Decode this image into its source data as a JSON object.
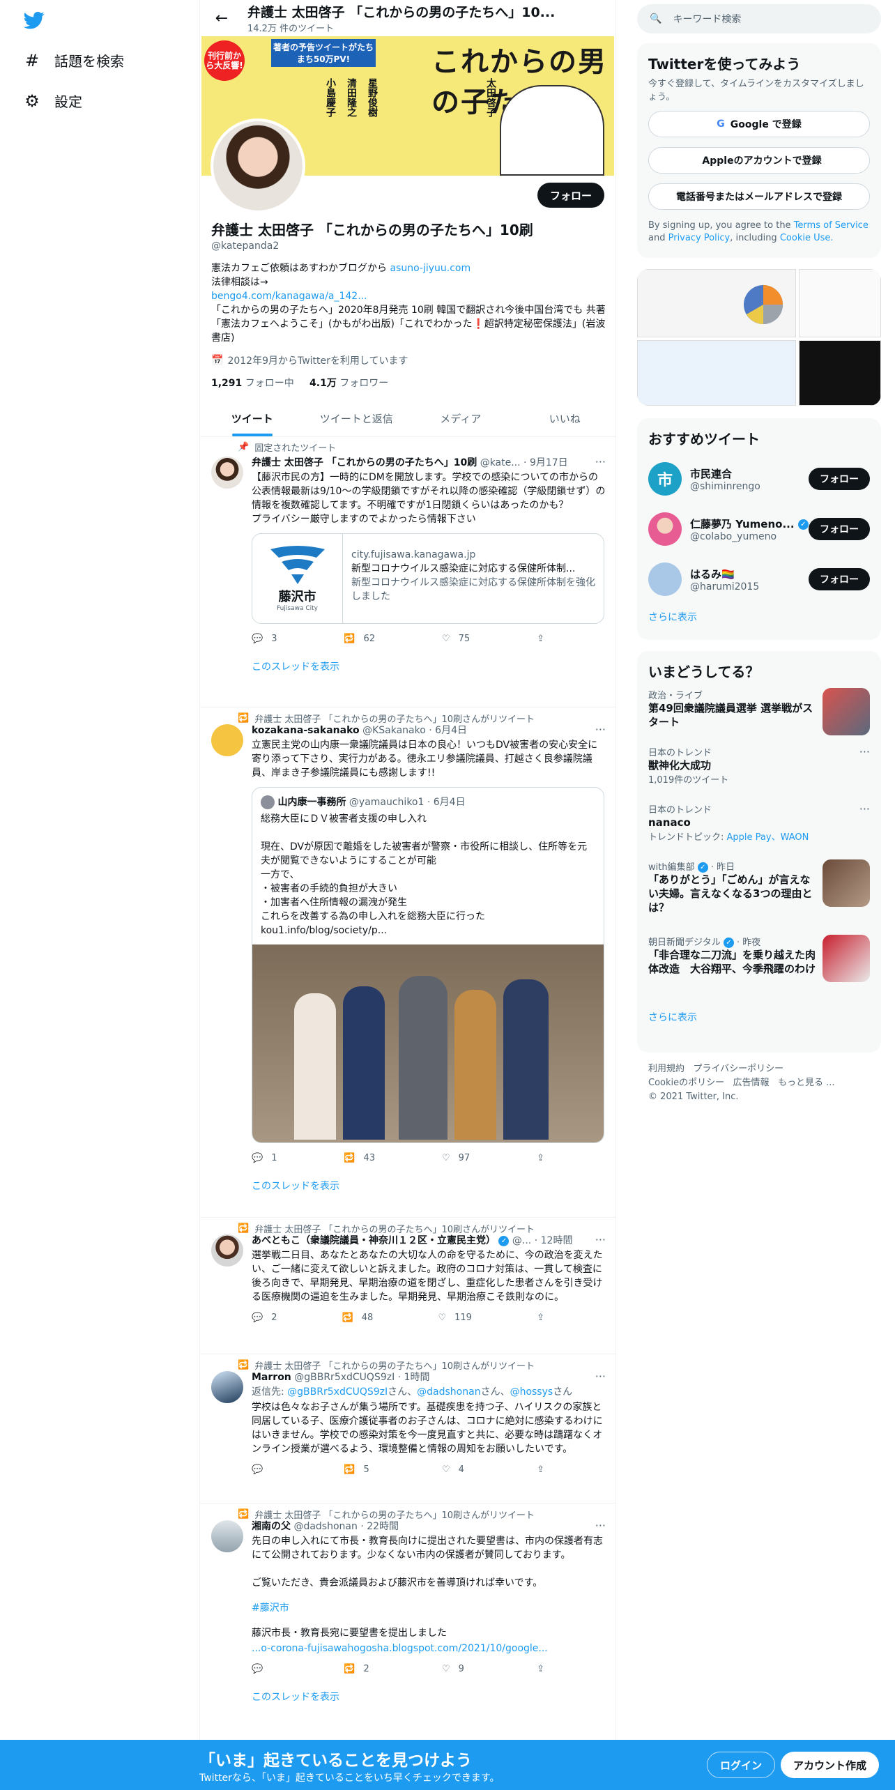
{
  "nav": {
    "explore_label": "話題を検索",
    "settings_label": "設定"
  },
  "header": {
    "title": "弁護士 太田啓子 「これからの男の子たちへ」10...",
    "tweet_count": "14.2万 件のツイート"
  },
  "banner": {
    "badge": "刊行前から大反響!",
    "promo": "著者の予告ツイートがたちまち50万PV!",
    "book_title": "これからの男の子たちへ",
    "authors": [
      "小島慶子",
      "清田隆之",
      "星野俊樹",
      "太田啓子"
    ]
  },
  "profile": {
    "name": "弁護士 太田啓子 「これからの男の子たちへ」10刷",
    "handle": "@katepanda2",
    "follow_label": "フォロー",
    "bio_line1": "憲法カフェご依頼はあすわかブログから",
    "bio_link1": "asuno-jiyuu.com",
    "bio_line2": "法律相談は→",
    "bio_link2": "bengo4.com/kanagawa/a_142...",
    "bio_line3": "「これからの男の子たちへ」2020年8月発売 10刷 韓国で翻訳され今後中国台湾でも 共著「憲法カフェへようこそ」(かもがわ出版)「これでわかった❗超訳特定秘密保護法」(岩波書店)",
    "joined": "2012年9月からTwitterを利用しています",
    "following_count": "1,291",
    "following_label": "フォロー中",
    "followers_count": "4.1万",
    "followers_label": "フォロワー"
  },
  "tabs": [
    "ツイート",
    "ツイートと返信",
    "メディア",
    "いいね"
  ],
  "tweets": [
    {
      "context": "固定されたツイート",
      "name": "弁護士 太田啓子 「これからの男の子たちへ」10刷",
      "handle": "@kate...",
      "time": "9月17日",
      "text": "【藤沢市民の方】一時的にDMを開放します。学校での感染についての市からの公表情報最新は9/10～の学級閉鎖ですがそれ以降の感染確認（学級閉鎖せず）の情報を複数確認してます。不明確ですが1日閉鎖くらいはあったのかも？\nプライバシー厳守しますのでよかったら情報下さい",
      "card_logo": "藤沢市",
      "card_logo_en": "Fujisawa City",
      "card_domain": "city.fujisawa.kanagawa.jp",
      "card_title": "新型コロナウイルス感染症に対応する保健所体制...",
      "card_desc": "新型コロナウイルス感染症に対応する保健所体制を強化しました",
      "replies": "3",
      "retweets": "62",
      "likes": "75",
      "show_thread": "このスレッドを表示"
    },
    {
      "context": "弁護士 太田啓子 「これからの男の子たちへ」10刷さんがリツイート",
      "name": "kozakana-sakanako",
      "handle": "@KSakanako",
      "time": "6月4日",
      "text": "立憲民主党の山内康一衆議院議員は日本の良心！いつもDV被害者の安心安全に寄り添って下さり、実行力がある。徳永エリ参議院議員、打越さく良参議院議員、岸まき子参議院議員にも感謝します!!",
      "quote_name": "山内康一事務所",
      "quote_handle": "@yamauchiko1",
      "quote_time": "6月4日",
      "quote_text": "総務大臣にＤＶ被害者支援の申し入れ\n\n現在、DVが原因で離婚をした被害者が警察・市役所に相談し、住所等を元夫が閲覧できないようにすることが可能\n一方で、\n・被害者の手続的負担が大きい\n・加害者へ住所情報の漏洩が発生\nこれらを改善する為の申し入れを総務大臣に行った\nkou1.info/blog/society/p...",
      "replies": "1",
      "retweets": "43",
      "likes": "97",
      "show_thread": "このスレッドを表示"
    },
    {
      "context": "弁護士 太田啓子 「これからの男の子たちへ」10刷さんがリツイート",
      "name": "あべともこ（衆議院議員・神奈川１２区・立憲民主党）",
      "handle": "@...",
      "time": "12時間",
      "text": "選挙戦二日目、あなたとあなたの大切な人の命を守るために、今の政治を変えたい、ご一緒に変えて欲しいと訴えました。政府のコロナ対策は、一貫して検査に後ろ向きで、早期発見、早期治療の道を閉ざし、重症化した患者さんを引き受ける医療機関の逼迫を生みました。早期発見、早期治療こそ鉄則なのに。",
      "replies": "2",
      "retweets": "48",
      "likes": "119"
    },
    {
      "context": "弁護士 太田啓子 「これからの男の子たちへ」10刷さんがリツイート",
      "name": "Marron",
      "handle": "@gBBRr5xdCUQS9zI",
      "time": "1時間",
      "reply_prefix": "返信先:",
      "reply_to1": "@gBBRr5xdCUQS9zI",
      "reply_to2": "@dadshonan",
      "reply_to3": "@hossys",
      "san": "さん",
      "text": "学校は色々なお子さんが集う場所です。基礎疾患を持つ子、ハイリスクの家族と同居している子、医療介護従事者のお子さんは、コロナに絶対に感染するわけにはいきません。学校での感染対策を今一度見直すと共に、必要な時は躊躇なくオンライン授業が選べるよう、環境整備と情報の周知をお願いしたいです。",
      "replies": "",
      "retweets": "5",
      "likes": "4"
    },
    {
      "context": "弁護士 太田啓子 「これからの男の子たちへ」10刷さんがリツイート",
      "name": "湘南の父",
      "handle": "@dadshonan",
      "time": "22時間",
      "text": "先日の申し入れにて市長・教育長向けに提出された要望書は、市内の保護者有志にて公開されております。少なくない市内の保護者が賛同しております。\n\nご覧いただき、貴会派議員および藤沢市を善導頂ければ幸いです。",
      "hashtag": "#藤沢市",
      "text2": "藤沢市長・教育長宛に要望書を提出しました",
      "link": "...o-corona-fujisawahogosha.blogspot.com/2021/10/google...",
      "replies": "",
      "retweets": "2",
      "likes": "9",
      "show_thread": "このスレッドを表示"
    }
  ],
  "right": {
    "search_placeholder": "キーワード検索",
    "signup_title": "Twitterを使ってみよう",
    "signup_desc": "今すぐ登録して、タイムラインをカスタマイズしましょう。",
    "google_btn": "Google で登録",
    "apple_btn": "Appleのアカウントで登録",
    "phone_btn": "電話番号またはメールアドレスで登録",
    "terms_pre": "By signing up, you agree to the",
    "terms_link": "Terms of Service",
    "terms_and": "and",
    "privacy_link": "Privacy Policy",
    "terms_incl": ", including",
    "cookie_link": "Cookie Use.",
    "rec_title": "おすすめツイート",
    "recs": [
      {
        "name": "市民連合",
        "handle": "@shiminrengo",
        "follow": "フォロー"
      },
      {
        "name": "仁藤夢乃 Yumeno...",
        "handle": "@colabo_yumeno",
        "follow": "フォロー"
      },
      {
        "name": "はるみ🏳️‍🌈",
        "handle": "@harumi2015",
        "follow": "フォロー"
      }
    ],
    "show_more": "さらに表示",
    "trends_title": "いまどうしてる？",
    "trends": [
      {
        "cat": "政治・ライブ",
        "title": "第49回衆議院議員選挙 選挙戦がスタート",
        "sub": ""
      },
      {
        "cat": "日本のトレンド",
        "title": "獣神化大成功",
        "sub": "1,019件のツイート"
      },
      {
        "cat": "日本のトレンド",
        "title": "nanaco",
        "sub_pre": "トレンドトピック: ",
        "sub_links": "Apple Pay、WAON"
      },
      {
        "cat": "with編集部",
        "cat_time": "昨日",
        "title": "「ありがとう」「ごめん」が言えない夫婦。言えなくなる3つの理由とは？"
      },
      {
        "cat": "朝日新聞デジタル",
        "cat_time": "昨夜",
        "title": "「非合理な二刀流」を乗り越えた肉体改造　大谷翔平、今季飛躍のわけ"
      }
    ],
    "trends_more": "さらに表示",
    "footer": [
      "利用規約",
      "プライバシーポリシー",
      "Cookieのポリシー",
      "広告情報",
      "もっと見る ...",
      "© 2021 Twitter, Inc."
    ]
  },
  "bottom": {
    "title": "「いま」起きていることを見つけよう",
    "sub": "Twitterなら、「いま」起きていることをいち早くチェックできます。",
    "login": "ログイン",
    "signup": "アカウント作成"
  },
  "colors": {
    "accent": "#1d9bf0",
    "text": "#0f1419",
    "muted": "#536471"
  }
}
